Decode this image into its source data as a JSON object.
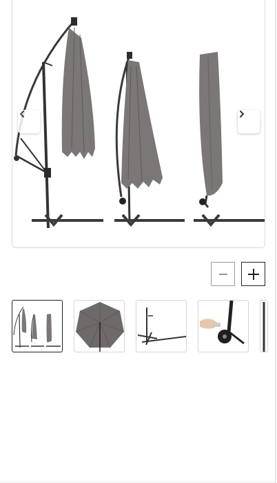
{
  "gallery": {
    "main_image": {
      "icon": "cantilever-parasol-illustration"
    },
    "prev_button": {
      "icon": "chevron-left-icon"
    },
    "next_button": {
      "icon": "chevron-right-icon"
    }
  },
  "zoom": {
    "zoom_out": {
      "icon": "minus-icon"
    },
    "zoom_in": {
      "icon": "plus-icon"
    }
  },
  "thumbnails": [
    {
      "icon": "parasol-three-views-thumbnail",
      "selected": true
    },
    {
      "icon": "parasol-canopy-top-view-thumbnail",
      "selected": false
    },
    {
      "icon": "cross-base-thumbnail",
      "selected": false
    },
    {
      "icon": "hand-crank-thumbnail",
      "selected": false
    },
    {
      "icon": "pole-thumbnail",
      "selected": false
    }
  ],
  "colors": {
    "canopy": "#7b7776",
    "frame": "#3a3a3a",
    "selected_border": "#222222",
    "thumb_border": "#d4d4d4"
  }
}
